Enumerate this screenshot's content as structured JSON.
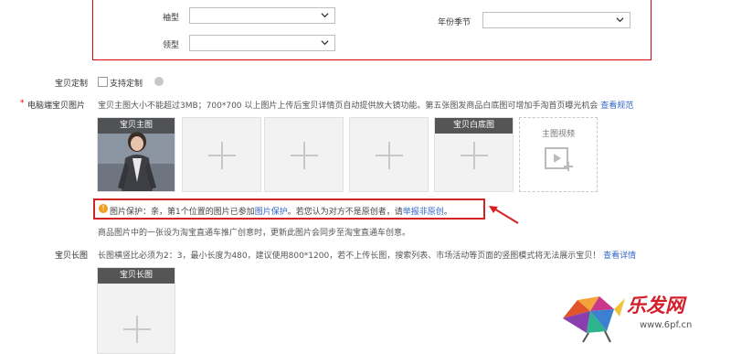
{
  "form_top": {
    "pattern_label": "袖型",
    "collar_label": "领型",
    "season_label": "年份季节",
    "pattern_value": "",
    "collar_value": "",
    "season_value": ""
  },
  "custom": {
    "label": "宝贝定制",
    "checkbox_label": "支持定制"
  },
  "pc_images": {
    "label": "电脑端宝贝图片",
    "required_mark": "*",
    "hint": "宝贝主图大小不能超过3MB；700*700 以上图片上传后宝贝详情页自动提供放大镜功能。第五张图发商品白底图可增加手淘首页曝光机会",
    "hint_link": "查看规范",
    "slots": [
      {
        "caption": "宝贝主图",
        "has_image": true
      },
      {
        "caption": "",
        "has_image": false
      },
      {
        "caption": "",
        "has_image": false
      },
      {
        "caption": "",
        "has_image": false
      },
      {
        "caption": "宝贝白底图",
        "has_image": false
      }
    ],
    "video_label": "主图视频"
  },
  "protect": {
    "title": "图片保护",
    "text1": "：亲，第1个位置的图片已参加",
    "link1": "图片保护",
    "text2": "。若您认为对方不是原创者，请",
    "link2": "举报非原创",
    "text3": "。"
  },
  "ztc_note": "商品图片中的一张设为淘宝直通车推广创意时，更新此图片会同步至淘宝直通车创意。",
  "long_image": {
    "label": "宝贝长图",
    "hint": "长图横竖比必须为2：3，最小长度为480，建议使用800*1200，若不上传长图，搜索列表、市场活动等页面的竖图模式将无法展示宝贝！",
    "hint_link": "查看详情",
    "caption": "宝贝长图"
  },
  "watermark": {
    "brand": "乐发网",
    "url": "www.6pf.cn"
  },
  "colors": {
    "accent_red": "#d42222",
    "link_blue": "#3366cc",
    "warn_orange": "#f0a020"
  }
}
